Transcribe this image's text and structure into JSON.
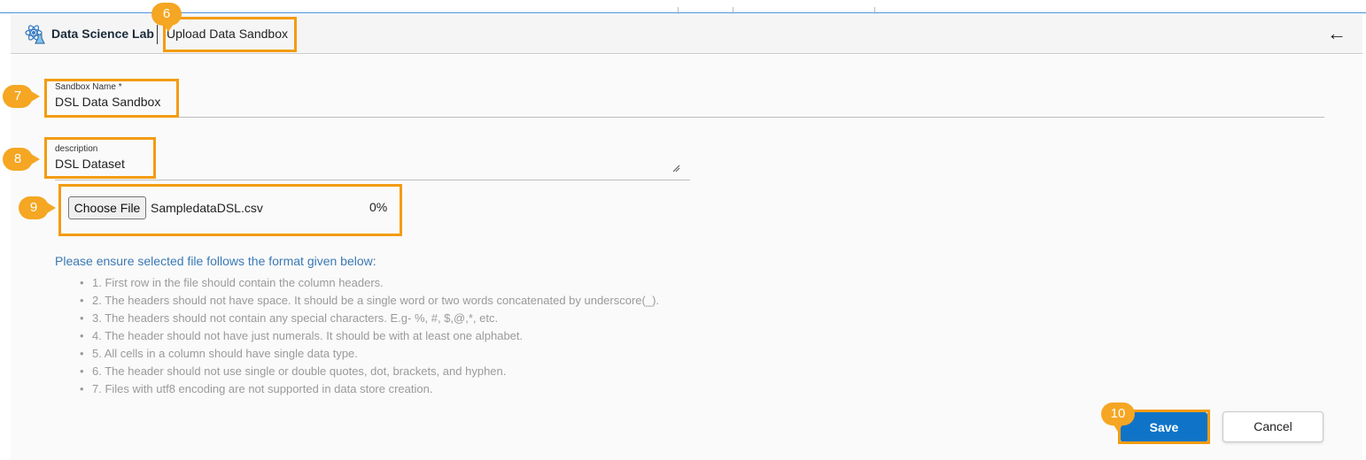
{
  "header": {
    "app_name": "Data Science Lab",
    "breadcrumb": "Upload Data Sandbox",
    "app_icon": "atom-flask-icon",
    "back_icon": "arrow-left-icon"
  },
  "form": {
    "sandbox_name_label": "Sandbox Name *",
    "sandbox_name_value": "DSL Data Sandbox",
    "description_label": "description",
    "description_value": "DSL Dataset",
    "choose_file_label": "Choose File",
    "file_name": "SampledataDSL.csv",
    "upload_progress": "0%"
  },
  "instructions": {
    "title": "Please ensure selected file follows the format given below:",
    "rules": [
      "1. First row in the file should contain the column headers.",
      "2. The headers should not have space. It should be a single word or two words concatenated by underscore(_).",
      "3. The headers should not contain any special characters. E.g- %, #, $,@,*, etc.",
      "4. The header should not have just numerals. It should be with at least one alphabet.",
      "5. All cells in a column should have single data type.",
      "6. The header should not use single or double quotes, dot, brackets, and hyphen.",
      "7. Files with utf8 encoding are not supported in data store creation."
    ]
  },
  "actions": {
    "save_label": "Save",
    "cancel_label": "Cancel"
  },
  "callouts": [
    "6",
    "7",
    "8",
    "9",
    "10"
  ],
  "colors": {
    "accent": "#0f74c8",
    "highlight": "#f39c12",
    "callout": "#f5a623",
    "instruction_title": "#3a79b5"
  }
}
